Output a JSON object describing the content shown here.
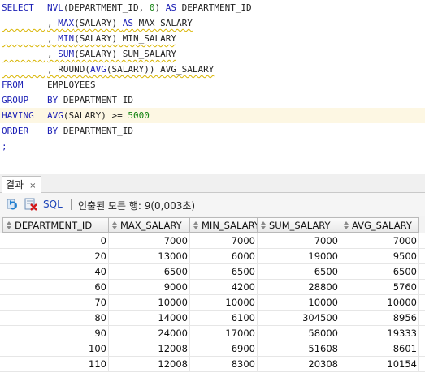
{
  "editor": {
    "lines": [
      {
        "c1": "SELECT",
        "parts": [
          {
            "t": "NVL",
            "k": "fn"
          },
          {
            "t": "(DEPARTMENT_ID, ",
            "k": "id"
          },
          {
            "t": "0",
            "k": "num"
          },
          {
            "t": ") ",
            "k": "id"
          },
          {
            "t": "AS",
            "k": "kw"
          },
          {
            "t": " DEPARTMENT_ID",
            "k": "id"
          }
        ],
        "squig": false
      },
      {
        "c1": "",
        "parts": [
          {
            "t": ", ",
            "k": "id"
          },
          {
            "t": "MAX",
            "k": "fn"
          },
          {
            "t": "(SALARY) ",
            "k": "id"
          },
          {
            "t": "AS",
            "k": "kw"
          },
          {
            "t": " MAX_SALARY",
            "k": "id"
          }
        ],
        "squig": true
      },
      {
        "c1": "",
        "parts": [
          {
            "t": ", ",
            "k": "id"
          },
          {
            "t": "MIN",
            "k": "fn"
          },
          {
            "t": "(SALARY) MIN_SALARY",
            "k": "id"
          }
        ],
        "squig": true
      },
      {
        "c1": "",
        "parts": [
          {
            "t": ", ",
            "k": "id"
          },
          {
            "t": "SUM",
            "k": "fn"
          },
          {
            "t": "(SALARY) SUM_SALARY",
            "k": "id"
          }
        ],
        "squig": true
      },
      {
        "c1": "",
        "parts": [
          {
            "t": ", ROUND(",
            "k": "id"
          },
          {
            "t": "AVG",
            "k": "fn"
          },
          {
            "t": "(SALARY)) AVG_SALARY",
            "k": "id"
          }
        ],
        "squig": true
      },
      {
        "c1": "FROM",
        "parts": [
          {
            "t": "EMPLOYEES",
            "k": "id"
          }
        ],
        "squig": false
      },
      {
        "c1": "GROUP",
        "parts": [
          {
            "t": "BY",
            "k": "kw"
          },
          {
            "t": " DEPARTMENT_ID",
            "k": "id"
          }
        ],
        "squig": false
      },
      {
        "c1": "HAVING",
        "parts": [
          {
            "t": "AVG",
            "k": "fn"
          },
          {
            "t": "(SALARY) >= ",
            "k": "id"
          },
          {
            "t": "5000",
            "k": "num"
          }
        ],
        "squig": false,
        "highlight": true
      },
      {
        "c1": "ORDER",
        "parts": [
          {
            "t": "BY",
            "k": "kw"
          },
          {
            "t": " DEPARTMENT_ID",
            "k": "id"
          }
        ],
        "squig": false
      },
      {
        "c1": ";",
        "parts": [],
        "squig": false
      }
    ]
  },
  "results": {
    "tab_label": "결과",
    "tab_close": "×",
    "sql_label": "SQL",
    "status_text": "인출된 모든 행: 9(0,003초)",
    "icons": [
      "refresh-icon",
      "delete-icon"
    ],
    "columns": [
      "DEPARTMENT_ID",
      "MAX_SALARY",
      "MIN_SALARY",
      "SUM_SALARY",
      "AVG_SALARY"
    ],
    "rows": [
      [
        "0",
        "7000",
        "7000",
        "7000",
        "7000"
      ],
      [
        "20",
        "13000",
        "6000",
        "19000",
        "9500"
      ],
      [
        "40",
        "6500",
        "6500",
        "6500",
        "6500"
      ],
      [
        "60",
        "9000",
        "4200",
        "28800",
        "5760"
      ],
      [
        "70",
        "10000",
        "10000",
        "10000",
        "10000"
      ],
      [
        "80",
        "14000",
        "6100",
        "304500",
        "8956"
      ],
      [
        "90",
        "24000",
        "17000",
        "58000",
        "19333"
      ],
      [
        "100",
        "12008",
        "6900",
        "51608",
        "8601"
      ],
      [
        "110",
        "12008",
        "8300",
        "20308",
        "10154"
      ]
    ]
  }
}
